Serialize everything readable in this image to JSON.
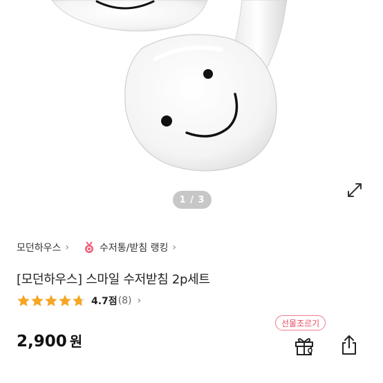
{
  "gallery": {
    "pager_text": "1 / 3",
    "expand_icon": "expand-icon"
  },
  "breadcrumb": {
    "store_label": "모던하우스",
    "ranking_label": "수저통/받침 랭킹",
    "chevron": "›",
    "medal_icon": "medal-icon"
  },
  "product": {
    "title": "[모던하우스] 스마일 수저받침 2p세트",
    "rating_score": "4.7점",
    "rating_count": "(8)",
    "rating_value": 4.7,
    "rating_max": 5,
    "price": "2,900",
    "price_unit": "원"
  },
  "actions": {
    "gift_badge": "선물조르기",
    "gift_icon": "gift-icon",
    "share_icon": "share-icon"
  },
  "colors": {
    "star": "#f5a623",
    "medal": "#f0607a",
    "gift_accent": "#e8475f"
  }
}
